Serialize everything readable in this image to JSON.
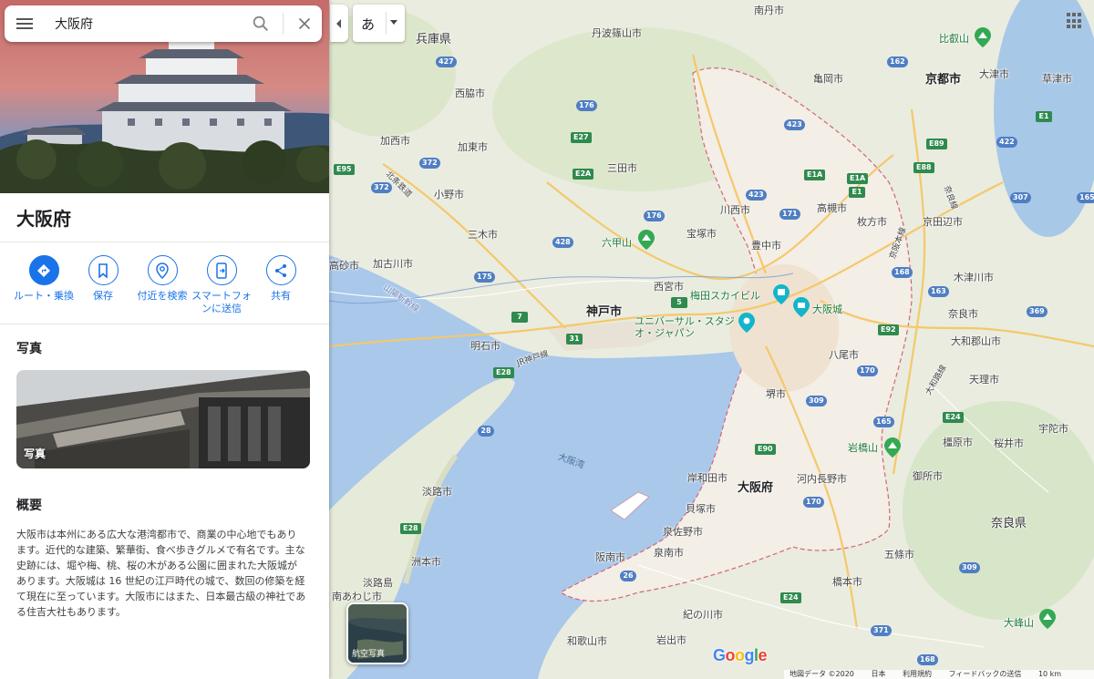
{
  "search": {
    "query": "大阪府"
  },
  "place": {
    "title": "大阪府"
  },
  "actions": [
    {
      "label": "ルート・乗換",
      "icon": "directions-icon"
    },
    {
      "label": "保存",
      "icon": "bookmark-icon"
    },
    {
      "label": "付近を検索",
      "icon": "nearby-icon"
    },
    {
      "label": "スマートフォンに送信",
      "icon": "send-to-phone-icon"
    },
    {
      "label": "共有",
      "icon": "share-icon"
    }
  ],
  "photos": {
    "section_title": "写真",
    "card_label": "写真"
  },
  "overview": {
    "section_title": "概要",
    "text": "大阪市は本州にある広大な港湾都市で、商業の中心地でもあります。近代的な建築、繁華街、食べ歩きグルメで有名です。主な史跡には、堀や梅、桃、桜の木がある公園に囲まれた大阪城があります。大阪城は 16 世紀の江戸時代の城で、数回の修築を経て現在に至っています。大阪市にはまた、日本最古級の神社である住吉大社もあります。"
  },
  "map": {
    "language": "あ",
    "aerial_label": "航空写真",
    "google": "Google",
    "footer": {
      "data": "地図データ ©2020",
      "country": "日本",
      "terms": "利用規約",
      "feedback": "フィードバックの送信",
      "scale": "10 km"
    },
    "labels": {
      "hyogo": "兵庫県",
      "nishiwaki": "西脇市",
      "kasai": "加西市",
      "kato": "加東市",
      "ono": "小野市",
      "miki": "三木市",
      "takasago": "高砂市",
      "kakogawa": "加古川市",
      "akashi": "明石市",
      "kobe": "神戸市",
      "nishinomiya": "西宮市",
      "takarazuka": "宝塚市",
      "kawanishi": "川西市",
      "sanda": "三田市",
      "tamba": "丹波篠山市",
      "nantan": "南丹市",
      "kameoka": "亀岡市",
      "kyoto": "京都市",
      "otsu": "大津市",
      "kusatsu": "草津市",
      "hiei": "比叡山",
      "takatsuki": "高槻市",
      "hirakata": "枚方市",
      "kyotanabe": "京田辺市",
      "kizugawa": "木津川市",
      "nara_city": "奈良市",
      "yamatokoriyama": "大和郡山市",
      "tenri": "天理市",
      "uda": "宇陀市",
      "sakurai": "桜井市",
      "kashihara": "橿原市",
      "gose": "御所市",
      "gojo": "五條市",
      "hashimoto": "橋本市",
      "nara_pref": "奈良県",
      "omine": "大峰山",
      "toyonaka": "豊中市",
      "yao": "八尾市",
      "sakai": "堺市",
      "kishiwada": "岸和田市",
      "kaizuka": "貝塚市",
      "izumisano": "泉佐野市",
      "sennan": "泉南市",
      "hannan": "阪南市",
      "kawachinagano": "河内長野市",
      "osaka_pref": "大阪府",
      "iwakisan": "岩橋山",
      "kinokawa": "紀の川市",
      "iwade": "岩出市",
      "wakayama": "和歌山市",
      "awaji": "淡路市",
      "sumoto": "洲本市",
      "awajishima": "淡路島",
      "minamiawaji": "南あわじ市",
      "rokko": "六甲山",
      "umeda": "梅田スカイビル",
      "osakajo": "大阪城",
      "usj": "ユニバーサル・スタジオ・ジャパン",
      "osaka_bay": "大阪湾",
      "jr_kobe": "JR神戸線",
      "sanyo": "山陽新幹線",
      "hokusetsu": "北条鉄道",
      "keihan": "京阪本線",
      "yamato": "大和路線",
      "nara_line": "奈良線"
    }
  }
}
